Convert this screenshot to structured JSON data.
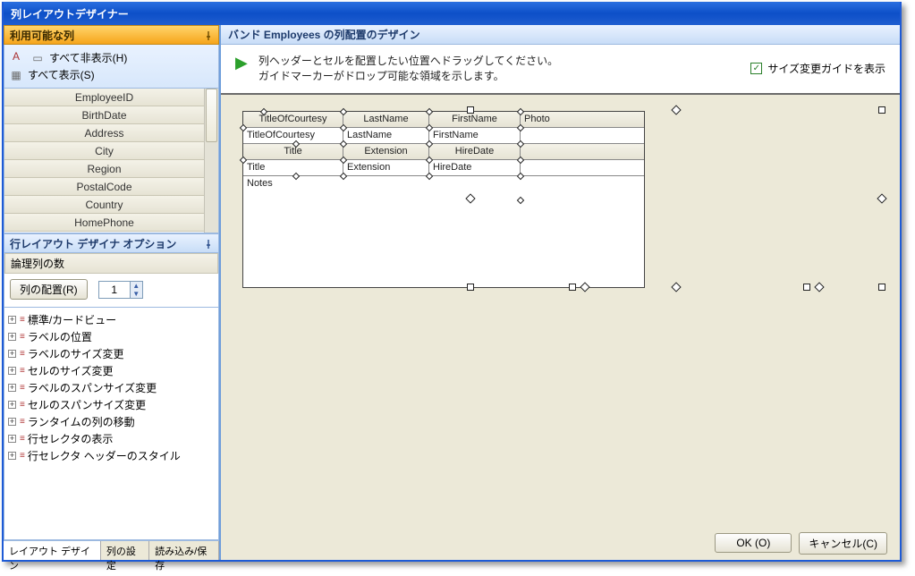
{
  "window_title": "列レイアウトデザイナー",
  "left": {
    "available_header": "利用可能な列",
    "hide_all": "すべて非表示(H)",
    "show_all": "すべて表示(S)",
    "items": [
      "EmployeeID",
      "BirthDate",
      "Address",
      "City",
      "Region",
      "PostalCode",
      "Country",
      "HomePhone"
    ],
    "options_header": "行レイアウト デザイナ オプション",
    "logical_cols_label": "論理列の数",
    "arrange_btn": "列の配置(R)",
    "spin_value": "1",
    "tree": [
      "標準/カードビュー",
      "ラベルの位置",
      "ラベルのサイズ変更",
      "セルのサイズ変更",
      "ラベルのスパンサイズ変更",
      "セルのスパンサイズ変更",
      "ランタイムの列の移動",
      "行セレクタの表示",
      "行セレクタ ヘッダーのスタイル"
    ],
    "tabs": [
      "レイアウト デザイン",
      "列の設定",
      "読み込み/保存"
    ]
  },
  "right": {
    "header": "バンド Employees の列配置のデザイン",
    "hint1": "列ヘッダーとセルを配置したい位置へドラッグしてください。",
    "hint2": "ガイドマーカーがドロップ可能な領域を示します。",
    "checkbox": "サイズ変更ガイドを表示",
    "layout": {
      "hdr1": [
        "TitleOfCourtesy",
        "LastName",
        "FirstName",
        "Photo"
      ],
      "cell1": [
        "TitleOfCourtesy",
        "LastName",
        "FirstName",
        ""
      ],
      "hdr2": [
        "Title",
        "Extension",
        "HireDate",
        ""
      ],
      "cell2": [
        "Title",
        "Extension",
        "HireDate",
        ""
      ],
      "notes": "Notes"
    }
  },
  "buttons": {
    "ok": "OK (O)",
    "cancel": "キャンセル(C)"
  }
}
